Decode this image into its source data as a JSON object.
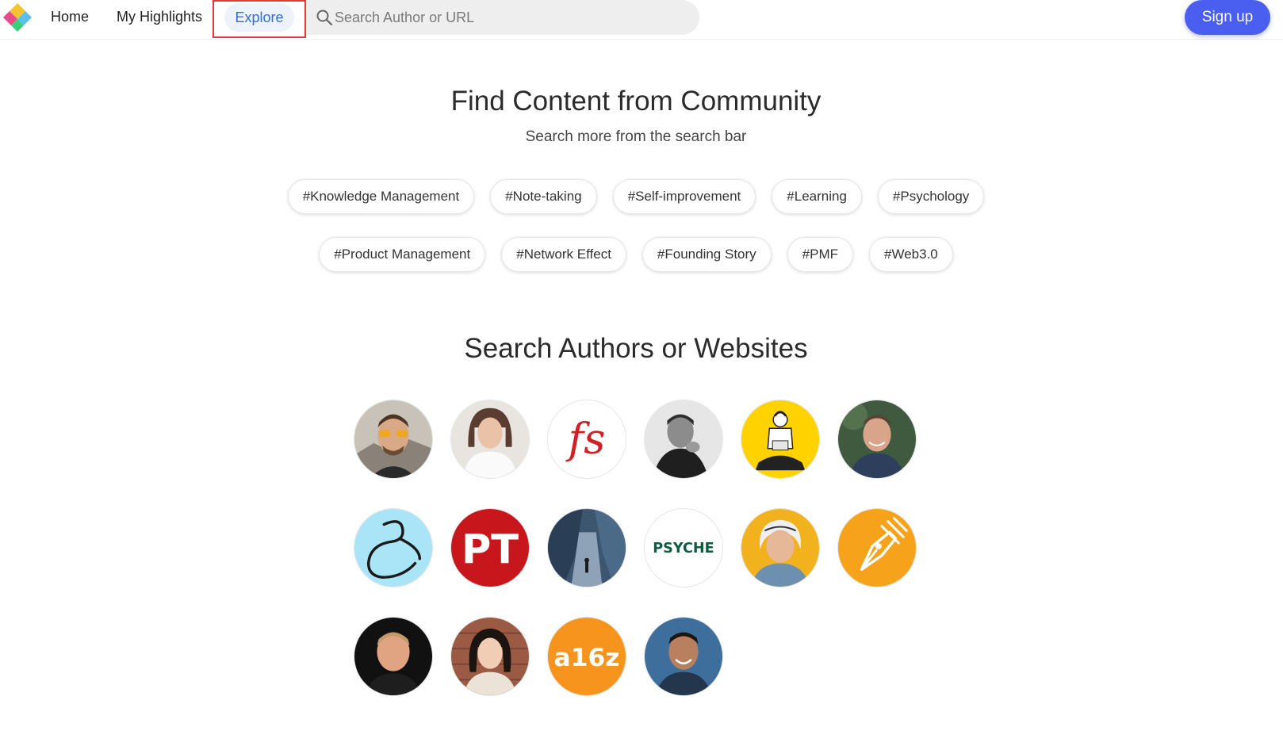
{
  "nav": {
    "home": "Home",
    "highlights": "My Highlights",
    "explore": "Explore",
    "search_placeholder": "Search Author or URL",
    "signup": "Sign up"
  },
  "section_community": {
    "title": "Find Content from Community",
    "subtitle": "Search more from the search bar"
  },
  "tags_row1": [
    "#Knowledge Management",
    "#Note-taking",
    "#Self-improvement",
    "#Learning",
    "#Psychology"
  ],
  "tags_row2": [
    "#Product Management",
    "#Network Effect",
    "#Founding Story",
    "#PMF",
    "#Web3.0"
  ],
  "section_authors": {
    "title": "Search Authors or Websites"
  },
  "avatar_logos": {
    "fs": "fs",
    "pt": "PT",
    "psyche": "PSYCHE",
    "a16z": "a16z"
  },
  "colors": {
    "accent_blue": "#4a5ff0",
    "explore_text": "#2f6ddb",
    "highlight_frame": "#e03a3a",
    "fs_red": "#d21f26",
    "pt_red": "#c8161d",
    "psyche_green": "#0e5c3f",
    "a16z_orange": "#f7941d",
    "pen_orange": "#f7a21b",
    "yellow_bg": "#ffd200"
  }
}
